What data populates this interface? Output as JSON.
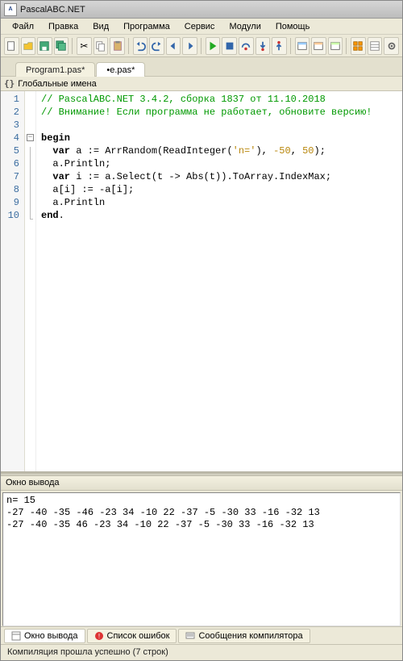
{
  "window": {
    "title": "PascalABC.NET"
  },
  "menu": {
    "file": "Файл",
    "edit": "Правка",
    "view": "Вид",
    "program": "Программа",
    "service": "Сервис",
    "modules": "Модули",
    "help": "Помощь"
  },
  "toolbar": {
    "t0": "new",
    "t1": "open",
    "t2": "save",
    "t3": "saveall",
    "t4": "cut",
    "t5": "copy",
    "t6": "paste",
    "t7": "undo",
    "t8": "redo",
    "t9": "back",
    "t10": "fwd",
    "t11": "run",
    "t12": "stop",
    "t13": "pause",
    "t14": "stepover",
    "t15": "stepinto",
    "t16": "compile",
    "t17": "build",
    "t18": "make",
    "t19": "forms",
    "t20": "options",
    "t21": "find"
  },
  "tabs": {
    "tab0": "Program1.pas*",
    "tab1": "•e.pas*"
  },
  "scope": {
    "label": "Глобальные имена"
  },
  "code": {
    "line_numbers": [
      "1",
      "2",
      "3",
      "4",
      "5",
      "6",
      "7",
      "8",
      "9",
      "10"
    ],
    "l1": "// PascalABC.NET 3.4.2, сборка 1837 от 11.10.2018",
    "l2": "// Внимание! Если программа не работает, обновите версию!",
    "l3": "",
    "l4_kw": "begin",
    "l5_a": "  ",
    "l5_kw": "var",
    "l5_b": " a := ArrRandom(ReadInteger(",
    "l5_str": "'n='",
    "l5_c": "), ",
    "l5_n1": "-50",
    "l5_d": ", ",
    "l5_n2": "50",
    "l5_e": ");",
    "l6": "  a.Println;",
    "l7_a": "  ",
    "l7_kw": "var",
    "l7_b": " i := a.Select(t -> Abs(t)).ToArray.IndexMax;",
    "l8": "  a[i] := -a[i];",
    "l9": "  a.Println",
    "l10_kw": "end",
    "l10_b": "."
  },
  "output": {
    "header": "Окно вывода",
    "line1": "n= 15",
    "line2": "-27 -40 -35 -46 -23 34 -10 22 -37 -5 -30 33 -16 -32 13",
    "line3": "-27 -40 -35 46 -23 34 -10 22 -37 -5 -30 33 -16 -32 13"
  },
  "bottom_tabs": {
    "t0": "Окно вывода",
    "t1": "Список ошибок",
    "t2": "Сообщения компилятора"
  },
  "status": {
    "text": "Компиляция прошла успешно (7 строк)"
  }
}
